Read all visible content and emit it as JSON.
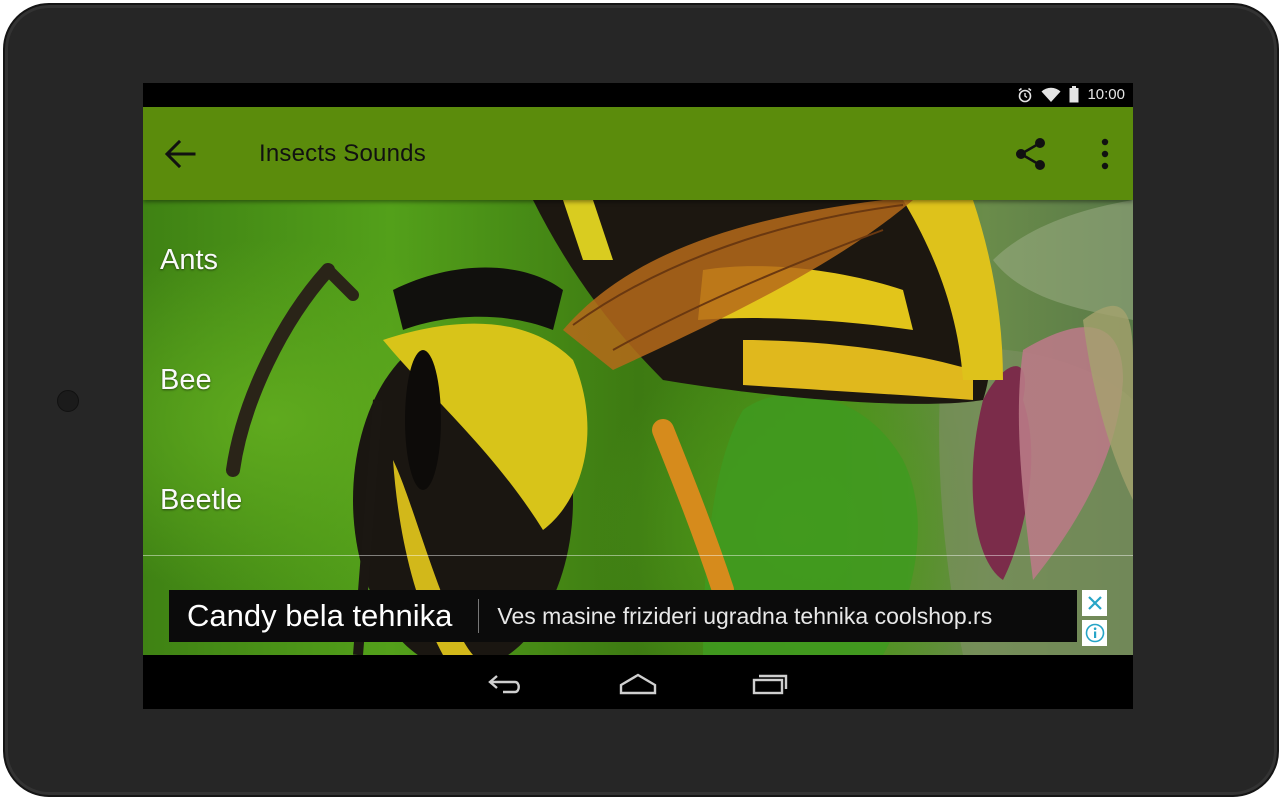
{
  "status_bar": {
    "time": "10:00",
    "icons": [
      "alarm-icon",
      "wifi-icon",
      "battery-icon"
    ]
  },
  "app_bar": {
    "title": "Insects Sounds",
    "back_icon": "arrow-back-icon",
    "share_icon": "share-icon",
    "more_icon": "more-vert-icon",
    "color": "#5b8c0c"
  },
  "list": {
    "items": [
      {
        "label": "Ants"
      },
      {
        "label": "Bee"
      },
      {
        "label": "Beetle"
      }
    ]
  },
  "ad": {
    "title": "Candy bela tehnika",
    "text": "Ves masine frizideri ugradna tehnika coolshop.rs",
    "close_icon": "close-icon",
    "info_icon": "info-icon"
  },
  "nav_bar": {
    "icons": [
      "back-nav-icon",
      "home-nav-icon",
      "recents-nav-icon"
    ]
  }
}
